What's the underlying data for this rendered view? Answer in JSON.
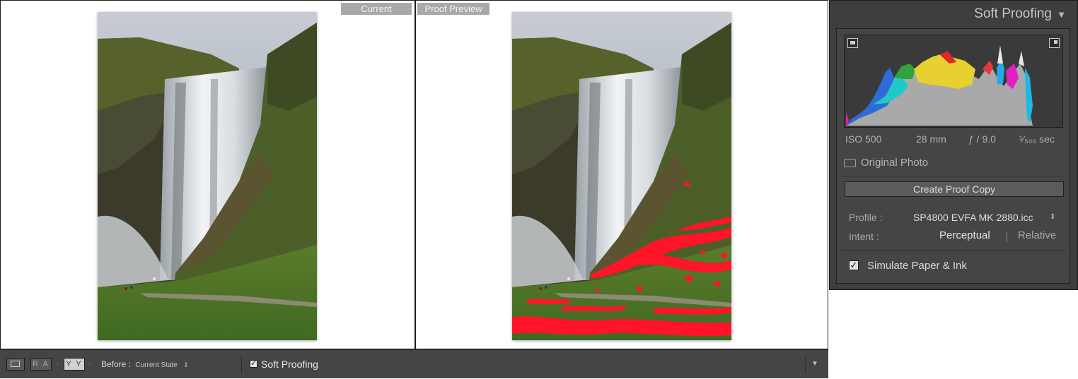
{
  "compare_view": {
    "left_label": "Current",
    "right_label": "Proof Preview"
  },
  "toolbar": {
    "loupe_icon": "single-view-icon",
    "ra_label": "R A",
    "yy_label": "Y Y",
    "before_label": "Before :",
    "before_value": "Current State",
    "before_arrows": "⇕",
    "soft_proofing_label": "Soft Proofing",
    "soft_proofing_checked": true,
    "menu_icon": "chevron-down-icon"
  },
  "panel": {
    "title": "Soft Proofing",
    "collapse_icon": "triangle-down-icon",
    "histogram": {
      "shadow_clip_icon": "shadow-clipping-icon",
      "highlight_clip_icon": "highlight-clipping-icon"
    },
    "exif": {
      "iso": "ISO 500",
      "focal": "28 mm",
      "fstop": "ƒ / 9.0",
      "shutter": "¹⁄₅₀₀ sec"
    },
    "original_photo_label": "Original Photo",
    "create_proof_copy_label": "Create Proof Copy",
    "profile_label": "Profile :",
    "profile_value": "SP4800 EVFA MK 2880.icc",
    "profile_arrows": "⇕",
    "intent_label": "Intent :",
    "intent_options": [
      "Perceptual",
      "Relative"
    ],
    "intent_selected": "Perceptual",
    "simulate_label": "Simulate Paper & Ink",
    "simulate_checked": true
  },
  "colors": {
    "gamut_warning": "#ff1428",
    "panel_bg": "#3e3e3e",
    "toolbar_bg": "#454545"
  }
}
